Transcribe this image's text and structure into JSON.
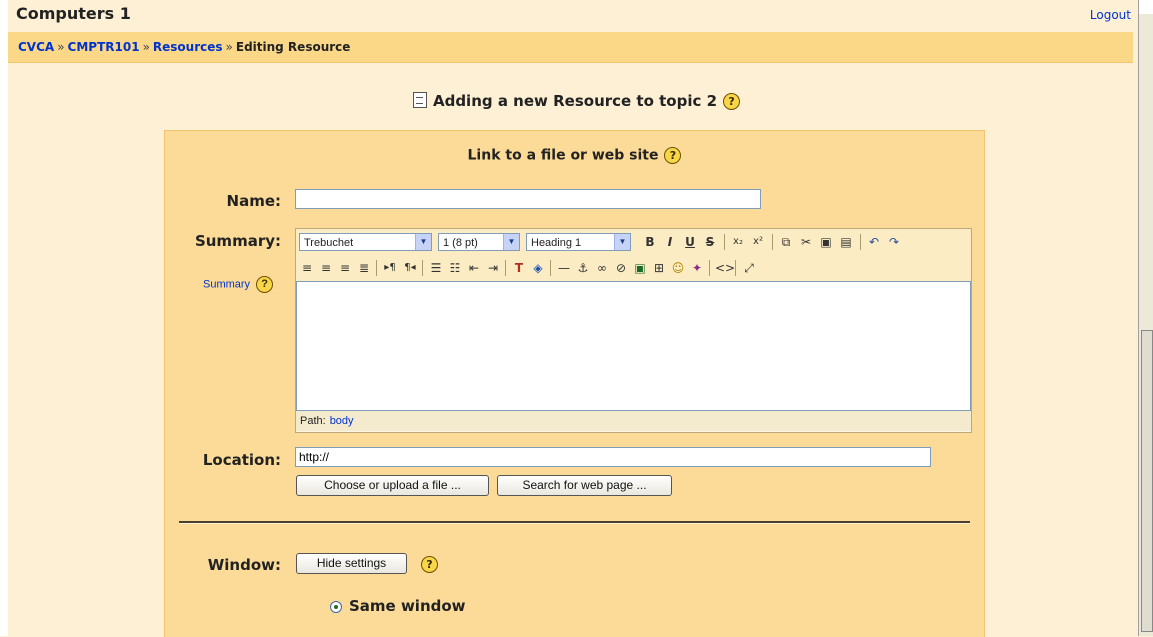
{
  "header": {
    "course_title": "Computers 1",
    "logout_label": "Logout"
  },
  "breadcrumb": {
    "items": [
      "CVCA",
      "CMPTR101",
      "Resources"
    ],
    "separator": "»",
    "current": "Editing Resource"
  },
  "page": {
    "heading": "Adding a new Resource to topic 2",
    "fieldset_title": "Link to a file or web site"
  },
  "form": {
    "name_label": "Name:",
    "name_value": "",
    "summary_label": "Summary:",
    "summary_help_link": "Summary",
    "location_label": "Location:",
    "location_value": "http://",
    "choose_button": "Choose or upload a file ...",
    "search_button": "Search for web page ...",
    "window_label": "Window:",
    "hide_settings_button": "Hide settings",
    "same_window_label": "Same window",
    "same_window_selected": true
  },
  "editor": {
    "font_select": "Trebuchet",
    "size_select": "1 (8 pt)",
    "format_select": "Heading 1",
    "content": "",
    "path_label": "Path:",
    "path_value": "body"
  },
  "help_symbol": "?",
  "colors": {
    "page_bg": "#fdf0d5",
    "navbar_bg": "#fbd887",
    "panel_bg": "#fbdb97",
    "link": "#0033cc"
  }
}
